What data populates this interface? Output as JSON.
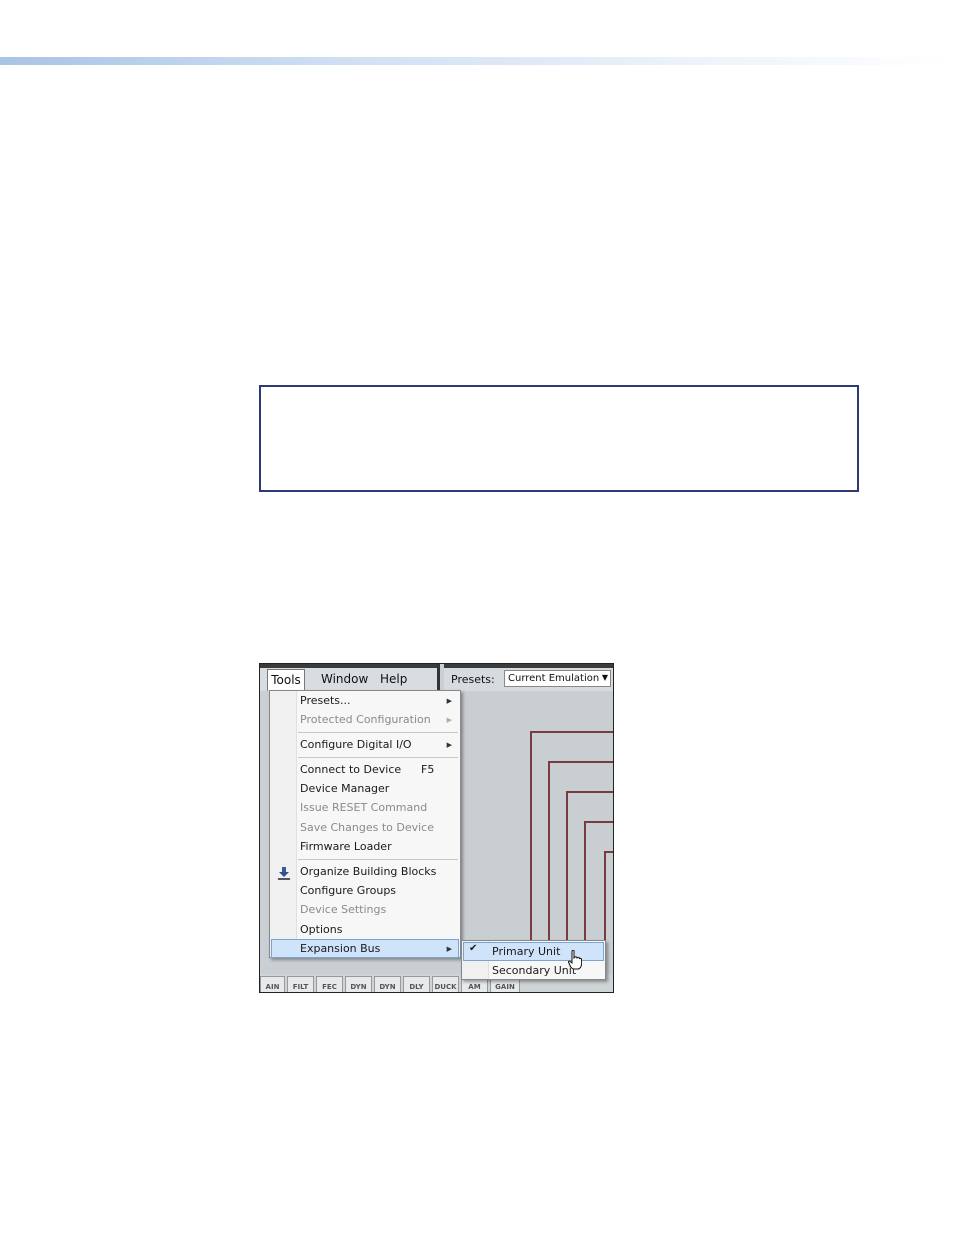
{
  "menubar": {
    "tabs": [
      {
        "label": "Tools"
      },
      {
        "label": "Window"
      },
      {
        "label": "Help"
      }
    ]
  },
  "presets": {
    "label": "Presets:",
    "selected": "Current Emulation"
  },
  "tools_menu": {
    "items": [
      {
        "label": "Presets...",
        "enabled": true
      },
      {
        "label": "Protected Configuration",
        "enabled": false
      },
      {
        "label": "Configure Digital I/O",
        "enabled": true
      },
      {
        "label": "Connect to Device",
        "shortcut": "F5",
        "enabled": true
      },
      {
        "label": "Device Manager",
        "enabled": true
      },
      {
        "label": "Issue RESET Command",
        "enabled": false
      },
      {
        "label": "Save Changes to Device",
        "enabled": false
      },
      {
        "label": "Firmware Loader",
        "enabled": true,
        "icon": "download-icon"
      },
      {
        "label": "Organize Building Blocks",
        "enabled": true
      },
      {
        "label": "Configure Groups",
        "enabled": true
      },
      {
        "label": "Device Settings",
        "enabled": false
      },
      {
        "label": "Options",
        "enabled": true
      },
      {
        "label": "Expansion Bus",
        "enabled": true,
        "highlighted": true
      }
    ]
  },
  "expansion_submenu": {
    "items": [
      {
        "label": "Primary Unit",
        "checked": true,
        "highlighted": true
      },
      {
        "label": "Secondary Unit",
        "checked": false
      }
    ]
  },
  "bottom_tabs": [
    "AIN",
    "FILT",
    "FEC",
    "DYN",
    "DYN",
    "DLY",
    "DUCK",
    "AM",
    "GAIN"
  ],
  "colors": {
    "wire": "#7a3a3f",
    "highlight": "#cfe3fb",
    "box_border": "#2e3a78"
  }
}
